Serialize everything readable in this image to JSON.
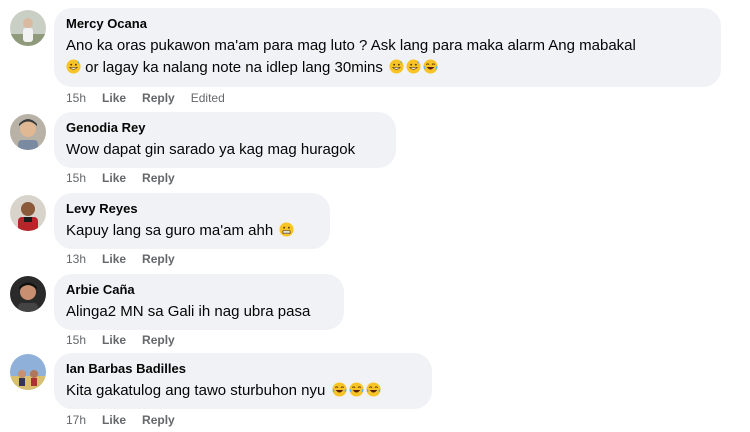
{
  "comments": [
    {
      "name": "Mercy Ocana",
      "text_line1": "Ano ka oras pukawon ma'am para mag luto ? Ask lang para maka alarm Ang mabakal",
      "text_line2": " or lagay ka nalang note na idlep lang 30mins ",
      "time": "15h",
      "like": "Like",
      "reply": "Reply",
      "edited": "Edited",
      "emojis_line1": [
        "grinning-sweat"
      ],
      "emojis_line2": [
        "grinning-sweat",
        "grinning-sweat",
        "tears-of-joy"
      ]
    },
    {
      "name": "Genodia Rey",
      "text": "Wow dapat gin sarado ya kag mag huragok",
      "time": "15h",
      "like": "Like",
      "reply": "Reply"
    },
    {
      "name": "Levy Reyes",
      "text": "Kapuy lang sa guro ma'am ahh ",
      "time": "13h",
      "like": "Like",
      "reply": "Reply",
      "emojis": [
        "grimacing"
      ]
    },
    {
      "name": "Arbie Caña",
      "text": "Alinga2 MN sa Gali ih nag ubra pasa",
      "time": "15h",
      "like": "Like",
      "reply": "Reply"
    },
    {
      "name": "Ian Barbas Badilles",
      "text": "Kita gakatulog ang tawo sturbuhon nyu ",
      "time": "17h",
      "like": "Like",
      "reply": "Reply",
      "emojis": [
        "tears-of-joy",
        "tears-of-joy",
        "tears-of-joy"
      ]
    }
  ],
  "colors": {
    "bubble": "#f0f2f5",
    "meta_text": "#65676b",
    "body_text": "#050505"
  }
}
